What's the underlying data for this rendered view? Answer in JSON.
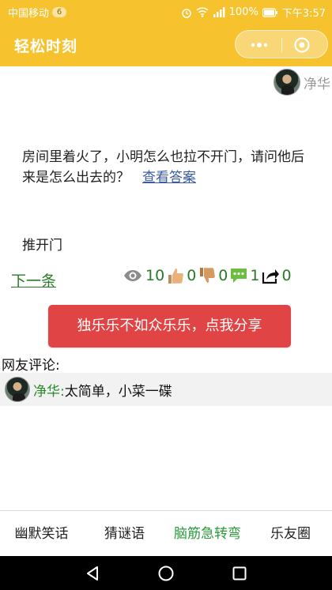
{
  "status_bar": {
    "carrier": "中国移动",
    "notification_count": "6",
    "battery": "100%",
    "time": "下午3:57"
  },
  "title_bar": {
    "title": "轻松时刻"
  },
  "post": {
    "author_name": "净华",
    "question": "房间里着火了，小明怎么也拉不开门，请问他后来是怎么出去的？",
    "view_answer_label": "查看答案",
    "answer": "推开门"
  },
  "actions": {
    "next_label": "下一条",
    "views": "10",
    "likes": "0",
    "dislikes": "0",
    "comments": "1",
    "shares": "0"
  },
  "share_button": {
    "label": "独乐乐不如众乐乐，点我分享"
  },
  "comments": {
    "title": "网友评论:",
    "items": [
      {
        "name": "净华:",
        "text": "太简单，小菜一碟"
      }
    ]
  },
  "tabs": [
    {
      "label": "幽默笑话"
    },
    {
      "label": "猜谜语"
    },
    {
      "label": "脑筋急转弯"
    },
    {
      "label": "乐友圈"
    }
  ],
  "colors": {
    "header": "#f6c22e",
    "share_button": "#e04444",
    "active_tab": "#2a9a3a",
    "link_green": "#2a7a2a"
  }
}
